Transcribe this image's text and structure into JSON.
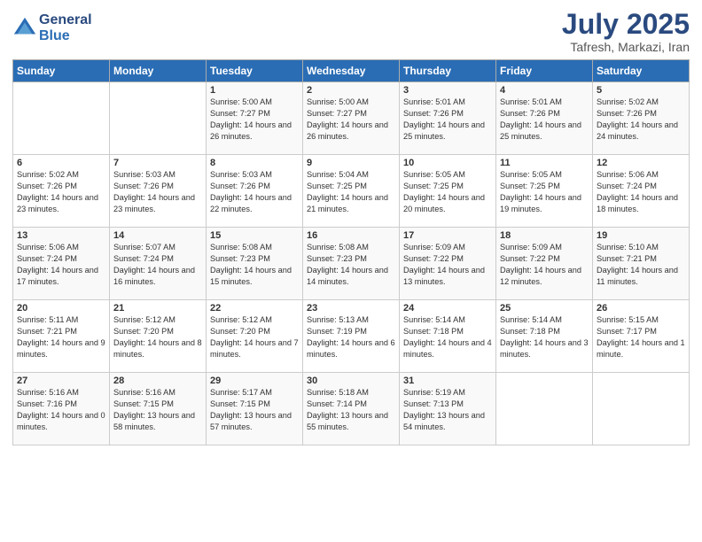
{
  "header": {
    "logo_line1": "General",
    "logo_line2": "Blue",
    "month": "July 2025",
    "location": "Tafresh, Markazi, Iran"
  },
  "days_of_week": [
    "Sunday",
    "Monday",
    "Tuesday",
    "Wednesday",
    "Thursday",
    "Friday",
    "Saturday"
  ],
  "weeks": [
    [
      {
        "day": "",
        "info": ""
      },
      {
        "day": "",
        "info": ""
      },
      {
        "day": "1",
        "info": "Sunrise: 5:00 AM\nSunset: 7:27 PM\nDaylight: 14 hours and 26 minutes."
      },
      {
        "day": "2",
        "info": "Sunrise: 5:00 AM\nSunset: 7:27 PM\nDaylight: 14 hours and 26 minutes."
      },
      {
        "day": "3",
        "info": "Sunrise: 5:01 AM\nSunset: 7:26 PM\nDaylight: 14 hours and 25 minutes."
      },
      {
        "day": "4",
        "info": "Sunrise: 5:01 AM\nSunset: 7:26 PM\nDaylight: 14 hours and 25 minutes."
      },
      {
        "day": "5",
        "info": "Sunrise: 5:02 AM\nSunset: 7:26 PM\nDaylight: 14 hours and 24 minutes."
      }
    ],
    [
      {
        "day": "6",
        "info": "Sunrise: 5:02 AM\nSunset: 7:26 PM\nDaylight: 14 hours and 23 minutes."
      },
      {
        "day": "7",
        "info": "Sunrise: 5:03 AM\nSunset: 7:26 PM\nDaylight: 14 hours and 23 minutes."
      },
      {
        "day": "8",
        "info": "Sunrise: 5:03 AM\nSunset: 7:26 PM\nDaylight: 14 hours and 22 minutes."
      },
      {
        "day": "9",
        "info": "Sunrise: 5:04 AM\nSunset: 7:25 PM\nDaylight: 14 hours and 21 minutes."
      },
      {
        "day": "10",
        "info": "Sunrise: 5:05 AM\nSunset: 7:25 PM\nDaylight: 14 hours and 20 minutes."
      },
      {
        "day": "11",
        "info": "Sunrise: 5:05 AM\nSunset: 7:25 PM\nDaylight: 14 hours and 19 minutes."
      },
      {
        "day": "12",
        "info": "Sunrise: 5:06 AM\nSunset: 7:24 PM\nDaylight: 14 hours and 18 minutes."
      }
    ],
    [
      {
        "day": "13",
        "info": "Sunrise: 5:06 AM\nSunset: 7:24 PM\nDaylight: 14 hours and 17 minutes."
      },
      {
        "day": "14",
        "info": "Sunrise: 5:07 AM\nSunset: 7:24 PM\nDaylight: 14 hours and 16 minutes."
      },
      {
        "day": "15",
        "info": "Sunrise: 5:08 AM\nSunset: 7:23 PM\nDaylight: 14 hours and 15 minutes."
      },
      {
        "day": "16",
        "info": "Sunrise: 5:08 AM\nSunset: 7:23 PM\nDaylight: 14 hours and 14 minutes."
      },
      {
        "day": "17",
        "info": "Sunrise: 5:09 AM\nSunset: 7:22 PM\nDaylight: 14 hours and 13 minutes."
      },
      {
        "day": "18",
        "info": "Sunrise: 5:09 AM\nSunset: 7:22 PM\nDaylight: 14 hours and 12 minutes."
      },
      {
        "day": "19",
        "info": "Sunrise: 5:10 AM\nSunset: 7:21 PM\nDaylight: 14 hours and 11 minutes."
      }
    ],
    [
      {
        "day": "20",
        "info": "Sunrise: 5:11 AM\nSunset: 7:21 PM\nDaylight: 14 hours and 9 minutes."
      },
      {
        "day": "21",
        "info": "Sunrise: 5:12 AM\nSunset: 7:20 PM\nDaylight: 14 hours and 8 minutes."
      },
      {
        "day": "22",
        "info": "Sunrise: 5:12 AM\nSunset: 7:20 PM\nDaylight: 14 hours and 7 minutes."
      },
      {
        "day": "23",
        "info": "Sunrise: 5:13 AM\nSunset: 7:19 PM\nDaylight: 14 hours and 6 minutes."
      },
      {
        "day": "24",
        "info": "Sunrise: 5:14 AM\nSunset: 7:18 PM\nDaylight: 14 hours and 4 minutes."
      },
      {
        "day": "25",
        "info": "Sunrise: 5:14 AM\nSunset: 7:18 PM\nDaylight: 14 hours and 3 minutes."
      },
      {
        "day": "26",
        "info": "Sunrise: 5:15 AM\nSunset: 7:17 PM\nDaylight: 14 hours and 1 minute."
      }
    ],
    [
      {
        "day": "27",
        "info": "Sunrise: 5:16 AM\nSunset: 7:16 PM\nDaylight: 14 hours and 0 minutes."
      },
      {
        "day": "28",
        "info": "Sunrise: 5:16 AM\nSunset: 7:15 PM\nDaylight: 13 hours and 58 minutes."
      },
      {
        "day": "29",
        "info": "Sunrise: 5:17 AM\nSunset: 7:15 PM\nDaylight: 13 hours and 57 minutes."
      },
      {
        "day": "30",
        "info": "Sunrise: 5:18 AM\nSunset: 7:14 PM\nDaylight: 13 hours and 55 minutes."
      },
      {
        "day": "31",
        "info": "Sunrise: 5:19 AM\nSunset: 7:13 PM\nDaylight: 13 hours and 54 minutes."
      },
      {
        "day": "",
        "info": ""
      },
      {
        "day": "",
        "info": ""
      }
    ]
  ]
}
